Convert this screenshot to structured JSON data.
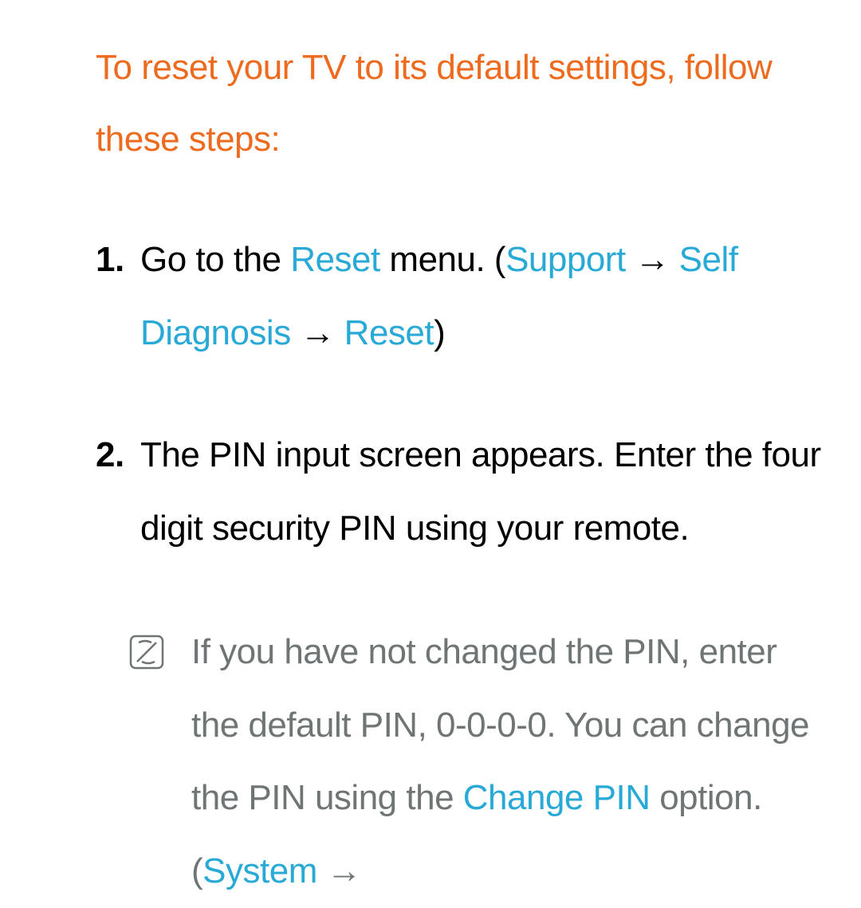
{
  "heading": "To reset your TV to its default settings, follow these steps:",
  "steps": [
    {
      "parts": [
        {
          "text": "Go to the ",
          "type": "plain"
        },
        {
          "text": "Reset",
          "type": "link"
        },
        {
          "text": " menu. (",
          "type": "plain"
        },
        {
          "text": "Support",
          "type": "link"
        },
        {
          "text": " → ",
          "type": "arrow"
        },
        {
          "text": "Self Diagnosis",
          "type": "link"
        },
        {
          "text": " → ",
          "type": "arrow"
        },
        {
          "text": "Reset",
          "type": "link"
        },
        {
          "text": ")",
          "type": "plain"
        }
      ]
    },
    {
      "parts": [
        {
          "text": "The PIN input screen appears. Enter the four digit security PIN using your remote.",
          "type": "plain"
        }
      ]
    }
  ],
  "note": {
    "parts": [
      {
        "text": "If you have not changed the PIN, enter the default PIN, 0-0-0-0. You can change the PIN using the ",
        "type": "plain"
      },
      {
        "text": "Change PIN",
        "type": "link"
      },
      {
        "text": " option. (",
        "type": "plain"
      },
      {
        "text": "System",
        "type": "link"
      },
      {
        "text": " → ",
        "type": "arrow"
      }
    ]
  }
}
